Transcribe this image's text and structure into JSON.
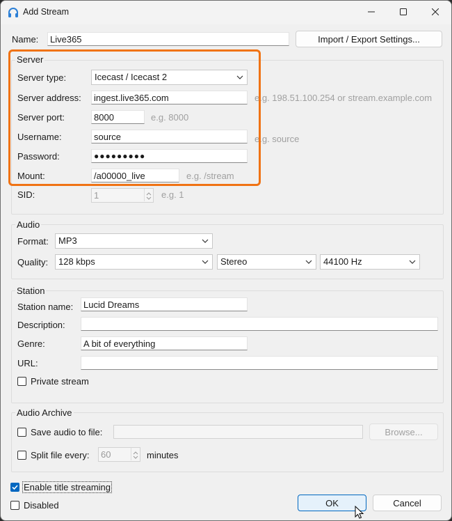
{
  "window": {
    "title": "Add Stream"
  },
  "name": {
    "label": "Name:",
    "value": "Live365"
  },
  "import_export_label": "Import / Export Settings...",
  "server": {
    "title": "Server",
    "type_label": "Server type:",
    "type_value": "Icecast / Icecast 2",
    "address_label": "Server address:",
    "address_value": "ingest.live365.com",
    "address_hint": "e.g. 198.51.100.254 or stream.example.com",
    "port_label": "Server port:",
    "port_value": "8000",
    "port_hint": "e.g. 8000",
    "username_label": "Username:",
    "username_value": "source",
    "username_hint": "e.g. source",
    "password_label": "Password:",
    "password_value": "●●●●●●●●●",
    "mount_label": "Mount:",
    "mount_value": "/a00000_live",
    "mount_hint": "e.g. /stream",
    "sid_label": "SID:",
    "sid_value": "1",
    "sid_hint": "e.g. 1"
  },
  "audio": {
    "title": "Audio",
    "format_label": "Format:",
    "format_value": "MP3",
    "quality_label": "Quality:",
    "bitrate_value": "128 kbps",
    "channels_value": "Stereo",
    "samplerate_value": "44100 Hz"
  },
  "station": {
    "title": "Station",
    "name_label": "Station name:",
    "name_value": "Lucid Dreams",
    "description_label": "Description:",
    "description_value": "",
    "genre_label": "Genre:",
    "genre_value": "A bit of everything",
    "url_label": "URL:",
    "url_value": "",
    "private_label": "Private stream"
  },
  "archive": {
    "title": "Audio Archive",
    "save_label": "Save audio to file:",
    "path_value": "",
    "browse_label": "Browse...",
    "split_label": "Split file every:",
    "split_value": "60",
    "minutes_label": "minutes"
  },
  "enable_title_label": "Enable title streaming",
  "disabled_label": "Disabled",
  "ok_label": "OK",
  "cancel_label": "Cancel",
  "colors": {
    "accent": "#0067c0",
    "highlight": "#f07314"
  },
  "icons": [
    "headphones-icon",
    "minimize-icon",
    "maximize-icon",
    "close-icon",
    "chevron-down-icon",
    "checkmark-icon",
    "mouse-pointer-icon"
  ]
}
